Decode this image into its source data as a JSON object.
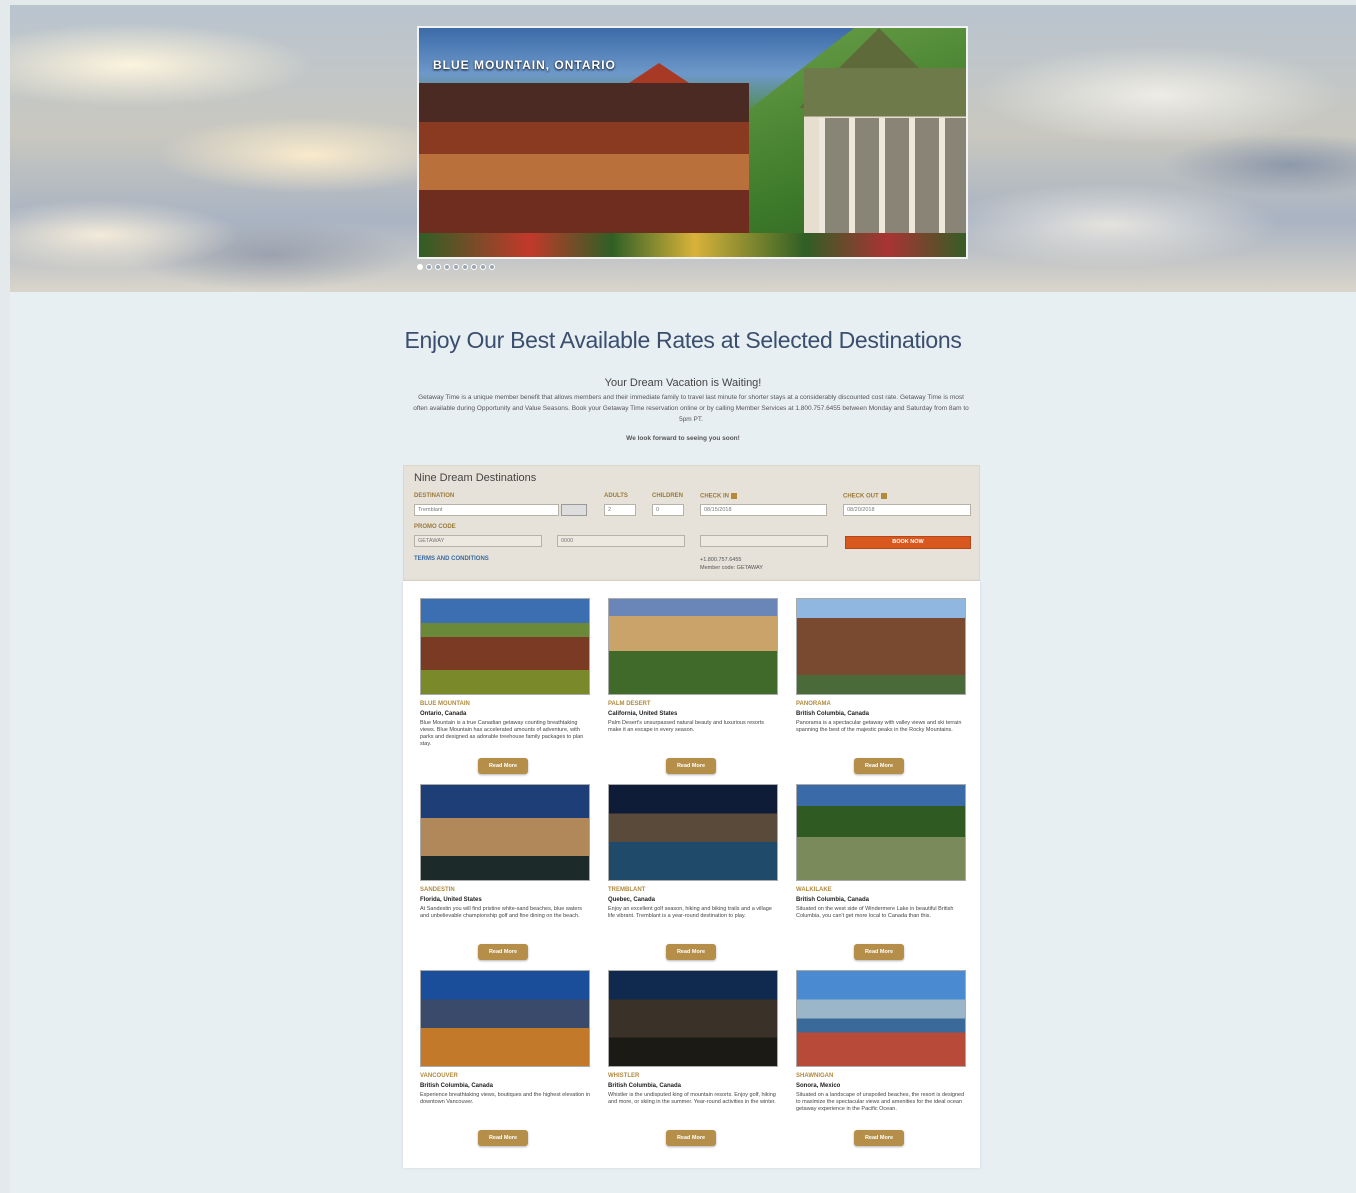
{
  "hero": {
    "caption": "BLUE MOUNTAIN, ONTARIO",
    "dots": [
      true,
      false,
      false,
      false,
      false,
      false,
      false,
      false,
      false
    ]
  },
  "intro": {
    "heading": "Enjoy Our Best Available Rates at Selected Destinations",
    "subheading": "Your Dream Vacation is Waiting!",
    "body": "Getaway Time is a unique member benefit that allows members and their immediate family to travel last minute for shorter stays at a considerably discounted cost rate. Getaway Time is most often available during Opportunity and Value Seasons. Book your Getaway Time reservation online or by calling Member Services at 1.800.757.6455 between Monday and Saturday from 8am to 5pm PT.",
    "signoff": "We look forward to seeing you soon!"
  },
  "booking": {
    "title": "Nine Dream Destinations",
    "destination_label": "DESTINATION",
    "destination_value": "Tremblant",
    "adults_label": "ADULTS",
    "adults_value": "2",
    "children_label": "CHILDREN",
    "children_value": "0",
    "checkin_label": "CHECK IN",
    "checkin_value": "08/15/2018",
    "checkout_label": "CHECK OUT",
    "checkout_value": "08/20/2018",
    "promo_label": "PROMO CODE",
    "promo_value": "GETAWAY",
    "field2_value": "0000",
    "book_label": "BOOK NOW",
    "terms_label": "TERMS AND CONDITIONS",
    "phone": "+1.800.757.6455",
    "member_code": "Member code: GETAWAY"
  },
  "destinations": [
    {
      "name": "BLUE MOUNTAIN",
      "location": "Ontario, Canada",
      "desc": "Blue Mountain is a true Canadian getaway counting breathtaking views. Blue Mountain has accelerated amounts of adventure, with parks and designed as adorable treehouse family packages to plan stay.",
      "button": "Read More"
    },
    {
      "name": "PALM DESERT",
      "location": "California, United States",
      "desc": "Palm Desert's unsurpassed natural beauty and luxurious resorts make it an escape in every season.",
      "button": "Read More"
    },
    {
      "name": "PANORAMA",
      "location": "British Columbia, Canada",
      "desc": "Panorama is a spectacular getaway with valley views and ski terrain spanning the best of the majestic peaks in the Rocky Mountains.",
      "button": "Read More"
    },
    {
      "name": "SANDESTIN",
      "location": "Florida, United States",
      "desc": "At Sandestin you will find pristine white-sand beaches, blue waters and unbelievable championship golf and fine dining on the beach.",
      "button": "Read More"
    },
    {
      "name": "TREMBLANT",
      "location": "Quebec, Canada",
      "desc": "Enjoy an excellent golf season, hiking and biking trails and a village life vibrant. Tremblant is a year-round destination to play.",
      "button": "Read More"
    },
    {
      "name": "WALKILAKE",
      "location": "British Columbia, Canada",
      "desc": "Situated on the west side of Windermere Lake in beautiful British Columbia, you can't get more local to Canada than this.",
      "button": "Read More"
    },
    {
      "name": "VANCOUVER",
      "location": "British Columbia, Canada",
      "desc": "Experience breathtaking views, boutiques and the highest elevation in downtown Vancouver.",
      "button": "Read More"
    },
    {
      "name": "WHISTLER",
      "location": "British Columbia, Canada",
      "desc": "Whistler is the undisputed king of mountain resorts. Enjoy golf, hiking and more, or skiing in the summer. Year-round activities in the winter.",
      "button": "Read More"
    },
    {
      "name": "SHAWNIGAN",
      "location": "Sonora, Mexico",
      "desc": "Situated on a landscape of unspoiled beaches, the resort is designed to maximize the spectacular views and amenities for the ideal ocean getaway experience in the Pacific Ocean.",
      "button": "Read More"
    }
  ]
}
